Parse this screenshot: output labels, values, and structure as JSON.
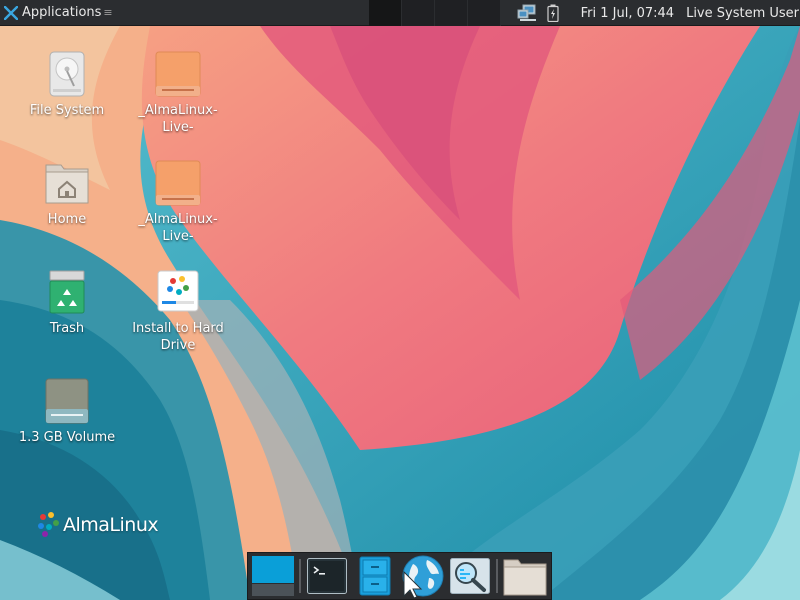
{
  "top_panel": {
    "applications_label": "Applications",
    "clock": "Fri  1 Jul, 07:44",
    "user": "Live System User",
    "workspace_count": 4
  },
  "desktop": {
    "icons": [
      {
        "label": "File System",
        "icon": "drive-icon"
      },
      {
        "label": "_AlmaLinux-Live-",
        "icon": "optical-drive-icon"
      },
      {
        "label": "Home",
        "icon": "home-folder-icon"
      },
      {
        "label": "_AlmaLinux-Live-",
        "icon": "optical-drive-icon"
      },
      {
        "label": "Trash",
        "icon": "trash-icon"
      },
      {
        "label": "Install to Hard Drive",
        "icon": "installer-icon"
      },
      {
        "label": "1.3 GB Volume",
        "icon": "volume-icon"
      }
    ],
    "logo_text": "AlmaLinux"
  },
  "dock": {
    "items": [
      {
        "name": "show-desktop",
        "icon": "show-desktop-icon"
      },
      {
        "name": "terminal",
        "icon": "terminal-icon"
      },
      {
        "name": "file-manager",
        "icon": "file-cabinet-icon"
      },
      {
        "name": "web-browser",
        "icon": "globe-icon"
      },
      {
        "name": "app-finder",
        "icon": "search-icon"
      },
      {
        "name": "home-folder",
        "icon": "folder-icon"
      }
    ]
  },
  "colors": {
    "panel_bg": "#2b2d30",
    "wallpaper_teal": "#2aa0b7",
    "wallpaper_pink": "#f07a80",
    "wallpaper_magenta": "#e35a7c"
  }
}
